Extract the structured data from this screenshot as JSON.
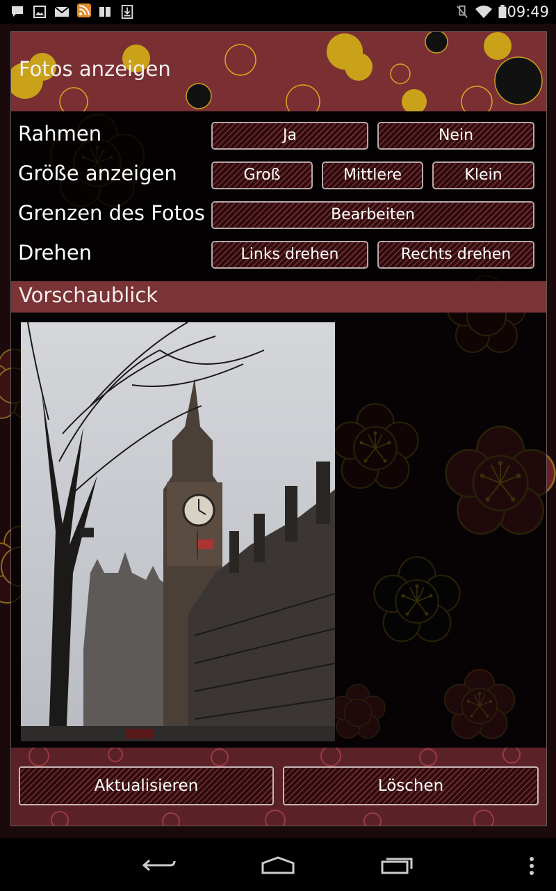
{
  "status_bar": {
    "time": "09:49",
    "left_icons": [
      "chat-icon",
      "image-icon",
      "mail-icon",
      "rss-icon",
      "book-icon",
      "download-icon"
    ],
    "right_icons": [
      "mute-icon",
      "wifi-icon",
      "battery-icon"
    ]
  },
  "dialog": {
    "title": "Fotos anzeigen",
    "rows": {
      "frame": {
        "label": "Rahmen",
        "options": [
          "Ja",
          "Nein"
        ]
      },
      "size": {
        "label": "Größe anzeigen",
        "options": [
          "Groß",
          "Mittlere",
          "Klein"
        ]
      },
      "crop": {
        "label": "Grenzen des Fotos",
        "action": "Bearbeiten"
      },
      "rotate": {
        "label": "Drehen",
        "options": [
          "Links drehen",
          "Rechts drehen"
        ]
      }
    },
    "preview": {
      "label": "Vorschaublick",
      "photo": "Big Ben and Portcullis House street scene"
    },
    "footer": {
      "refresh": "Aktualisieren",
      "delete": "Löschen"
    }
  },
  "nav_bar": {
    "icons": [
      "back-icon",
      "home-icon",
      "recents-icon",
      "menu-icon"
    ]
  },
  "colors": {
    "accent": "#7a2f33",
    "button_border": "#b8a8a8",
    "flower_gold": "#c9a21a"
  }
}
